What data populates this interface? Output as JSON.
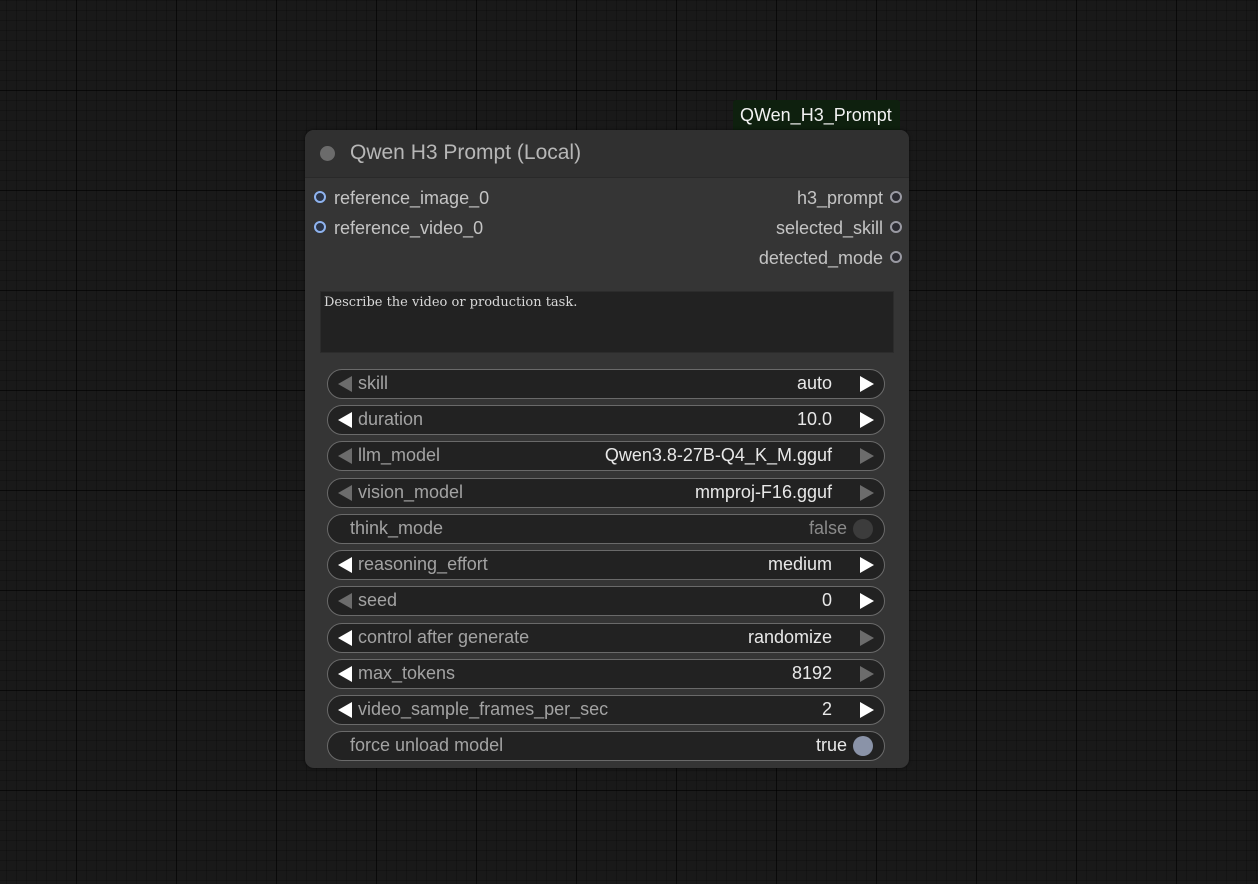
{
  "node": {
    "badge": "QWen_H3_Prompt",
    "title": "Qwen H3 Prompt (Local)",
    "inputs": [
      "reference_image_0",
      "reference_video_0"
    ],
    "outputs": [
      "h3_prompt",
      "selected_skill",
      "detected_mode"
    ],
    "prompt_text": "Describe the video or production task.",
    "widgets": [
      {
        "label": "skill",
        "value": "auto",
        "left_arrow": "disabled",
        "right_arrow": "enabled"
      },
      {
        "label": "duration",
        "value": "10.0",
        "left_arrow": "enabled",
        "right_arrow": "enabled"
      },
      {
        "label": "llm_model",
        "value": "Qwen3.8-27B-Q4_K_M.gguf",
        "left_arrow": "disabled",
        "right_arrow": "disabled"
      },
      {
        "label": "vision_model",
        "value": "mmproj-F16.gguf",
        "left_arrow": "disabled",
        "right_arrow": "disabled"
      },
      {
        "label": "think_mode",
        "value": "false",
        "type": "toggle",
        "state": "off"
      },
      {
        "label": "reasoning_effort",
        "value": "medium",
        "left_arrow": "enabled",
        "right_arrow": "enabled"
      },
      {
        "label": "seed",
        "value": "0",
        "left_arrow": "disabled",
        "right_arrow": "enabled"
      },
      {
        "label": "control after generate",
        "value": "randomize",
        "left_arrow": "enabled",
        "right_arrow": "disabled"
      },
      {
        "label": "max_tokens",
        "value": "8192",
        "left_arrow": "enabled",
        "right_arrow": "disabled"
      },
      {
        "label": "video_sample_frames_per_sec",
        "value": "2",
        "left_arrow": "enabled",
        "right_arrow": "enabled"
      },
      {
        "label": "force unload model",
        "value": "true",
        "type": "toggle",
        "state": "on"
      }
    ]
  },
  "colors": {
    "canvas_bg": "#191919",
    "node_bg": "#353535",
    "badge_bg": "#0e200e",
    "input_slot": "#8eb3ef",
    "output_slot": "#9a9aa3"
  }
}
